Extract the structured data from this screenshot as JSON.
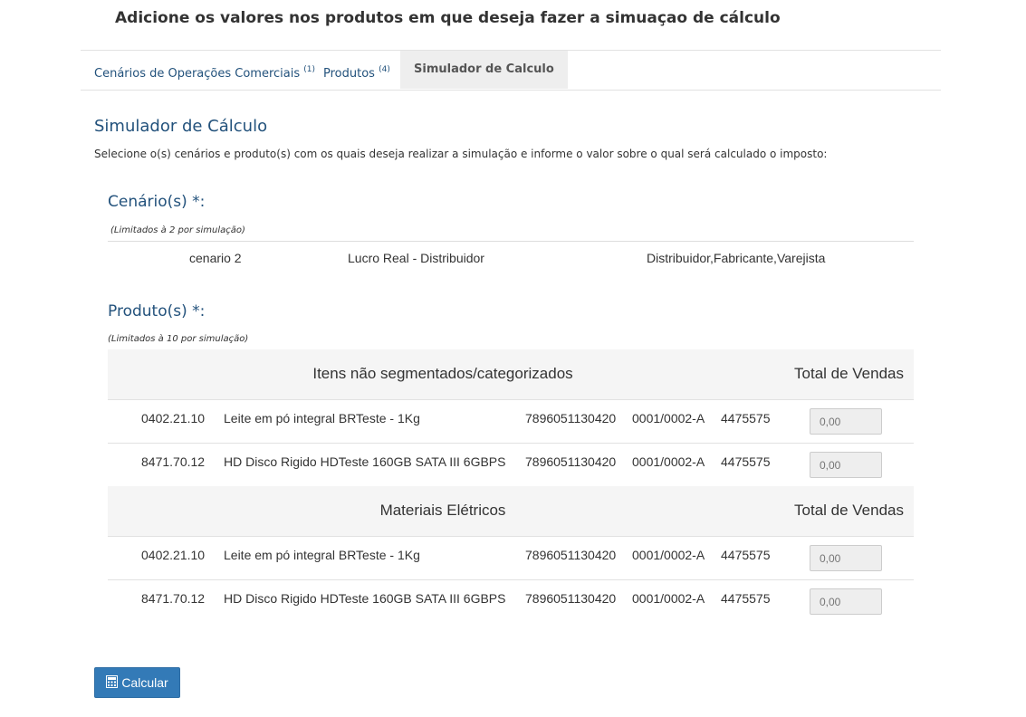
{
  "header": {
    "title": "Adicione os valores nos produtos em que deseja fazer a simuaçao de cálculo"
  },
  "tabs": [
    {
      "label": "Cenários de Operações Comerciais",
      "count": "(1)"
    },
    {
      "label": "Produtos",
      "count": "(4)"
    },
    {
      "label": "Simulador de Calculo",
      "count": ""
    }
  ],
  "simulator": {
    "title": "Simulador de Cálculo",
    "intro": "Selecione o(s) cenários e produto(s) com os quais deseja realizar a simulação e informe o valor sobre o qual será calculado o imposto:"
  },
  "scenarios": {
    "label": "Cenário(s) *:",
    "limit": "(Limitados à 2 por simulação)",
    "row": {
      "name": "cenario 2",
      "regime": "Lucro Real - Distribuidor",
      "types": "Distribuidor,Fabricante,Varejista"
    }
  },
  "products": {
    "label": "Produto(s) *:",
    "limit": "(Limitados à 10 por simulação)",
    "groups": [
      {
        "title": "Itens não segmentados/categorizados",
        "total_label": "Total de Vendas",
        "rows": [
          {
            "ncm": "0402.21.10",
            "desc": "Leite em pó integral BRTeste - 1Kg",
            "ean": "7896051130420",
            "code": "0001/0002-A",
            "num": "4475575",
            "value": "0,00"
          },
          {
            "ncm": "8471.70.12",
            "desc": "HD Disco Rigido HDTeste 160GB SATA III 6GBPS",
            "ean": "7896051130420",
            "code": "0001/0002-A",
            "num": "4475575",
            "value": "0,00"
          }
        ]
      },
      {
        "title": "Materiais Elétricos",
        "total_label": "Total de Vendas",
        "rows": [
          {
            "ncm": "0402.21.10",
            "desc": "Leite em pó integral BRTeste - 1Kg",
            "ean": "7896051130420",
            "code": "0001/0002-A",
            "num": "4475575",
            "value": "0,00"
          },
          {
            "ncm": "8471.70.12",
            "desc": "HD Disco Rigido HDTeste 160GB SATA III 6GBPS",
            "ean": "7896051130420",
            "code": "0001/0002-A",
            "num": "4475575",
            "value": "0,00"
          }
        ]
      }
    ]
  },
  "actions": {
    "calculate_label": "Calcular",
    "calculate_icon": "calculator-icon"
  },
  "colors": {
    "primary": "#337ab7",
    "link": "#23527c",
    "header_bg": "#f5f5f5",
    "active_tab_bg": "#eeeeee"
  }
}
